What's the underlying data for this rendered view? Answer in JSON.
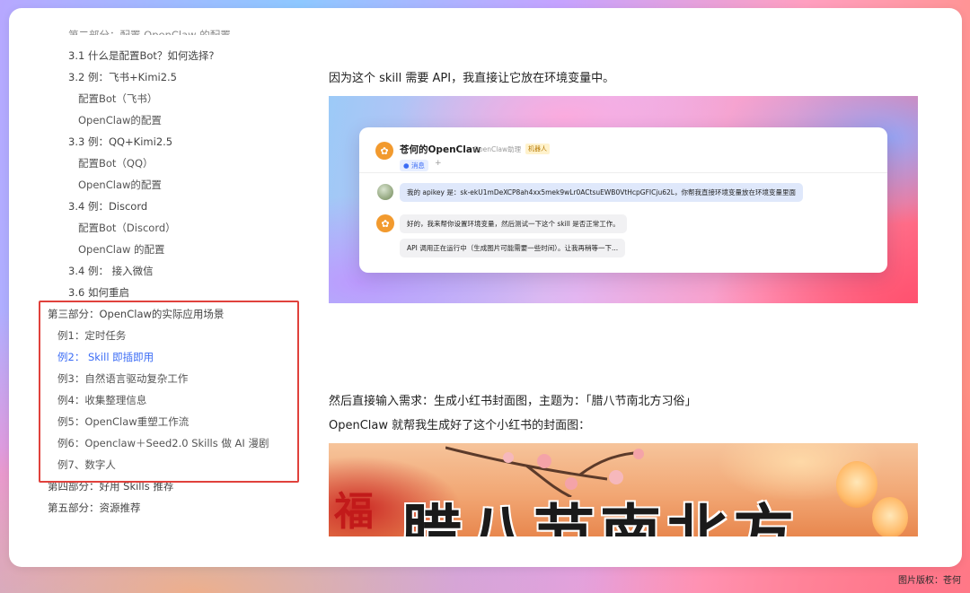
{
  "toc": {
    "cut_item": "第二部分：配置 OpenClaw 的配置",
    "items": [
      {
        "label": "3.1 什么是配置Bot？如何选择?",
        "level": "h2"
      },
      {
        "label": "3.2 例：飞书+Kimi2.5",
        "level": "h2"
      },
      {
        "label": "配置Bot（飞书）",
        "level": "h3"
      },
      {
        "label": "OpenClaw的配置",
        "level": "h3"
      },
      {
        "label": "3.3 例：QQ+Kimi2.5",
        "level": "h2"
      },
      {
        "label": "配置Bot（QQ）",
        "level": "h3"
      },
      {
        "label": "OpenClaw的配置",
        "level": "h3"
      },
      {
        "label": "3.4 例：Discord",
        "level": "h2"
      },
      {
        "label": "配置Bot（Discord）",
        "level": "h3"
      },
      {
        "label": "OpenClaw 的配置",
        "level": "h3"
      },
      {
        "label": "3.4 例： 接入微信",
        "level": "h2"
      },
      {
        "label": "3.6 如何重启",
        "level": "h2"
      },
      {
        "label": "第三部分：OpenClaw的实际应用场景",
        "level": "h1"
      },
      {
        "label": "例1：定时任务",
        "level": "h2b"
      },
      {
        "label": "例2： Skill 即插即用",
        "level": "h2b",
        "active": true
      },
      {
        "label": "例3：自然语言驱动复杂工作",
        "level": "h2b"
      },
      {
        "label": "例4：收集整理信息",
        "level": "h2b"
      },
      {
        "label": "例5：OpenClaw重塑工作流",
        "level": "h2b"
      },
      {
        "label": "例6：Openclaw＋Seed2.0 Skills 做 AI 漫剧",
        "level": "h2b"
      },
      {
        "label": "例7、数字人",
        "level": "h2b"
      },
      {
        "label": "第四部分：好用 Skills 推荐",
        "level": "h1"
      },
      {
        "label": "第五部分：资源推荐",
        "level": "h1"
      }
    ]
  },
  "content": {
    "para1": "因为这个 skill 需要 API，我直接让它放在环境变量中。",
    "para2": "然后直接输入需求：生成小红书封面图，主题为：「腊八节南北方习俗」",
    "para3": "OpenClaw 就帮我生成好了这个小红书的封面图："
  },
  "chat": {
    "title": "苍何的OpenClaw",
    "subtitle": "OpenClaw助理",
    "badge": "机器人",
    "tab": "消息",
    "plus": "+",
    "user_message": "我的 apikey 是：sk-ekU1mDeXCP8ah4xx5mek9wLr0ACtsuEWB0VtHcpGFICju62L，你帮我直接环境变量放在环境变量里面",
    "bot_message_1": "好的，我来帮你设置环境变量，然后测试一下这个 skill 是否正常工作。",
    "bot_message_2": "API 调用正在运行中（生成图片可能需要一些时间）。让我再稍等一下..."
  },
  "poster": {
    "title": "腊八节南北方",
    "fu": "福"
  },
  "credit": "图片版权：苍何",
  "colors": {
    "active_link": "#3b6cf5",
    "highlight_border": "#e0413c",
    "bot_avatar": "#f29a2e"
  }
}
